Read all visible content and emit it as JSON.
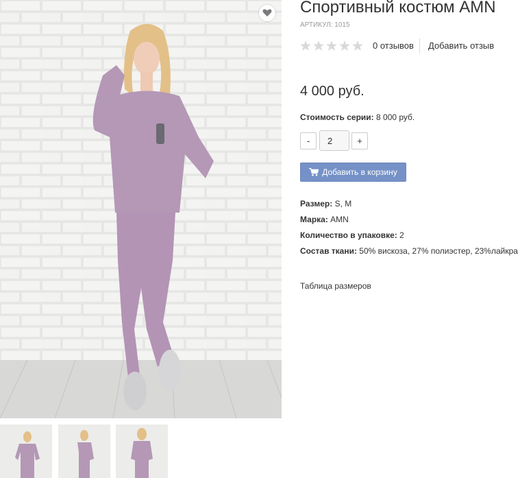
{
  "product": {
    "title": "Спортивный костюм AMN",
    "sku": "АРТИКУЛ: 1015",
    "rating": 0,
    "rating_max": 5,
    "reviews_count_label": "0 отзывов",
    "add_review_label": "Добавить отзыв",
    "price": "4 000 руб.",
    "series_label": "Стоимость серии:",
    "series_value": "8 000 руб."
  },
  "quantity": {
    "minus_label": "-",
    "value": "2",
    "plus_label": "+"
  },
  "cart": {
    "button_label": "Добавить в корзину",
    "icon": "shopping-cart-icon"
  },
  "attributes": [
    {
      "label": "Размер:",
      "value": "S, M"
    },
    {
      "label": "Марка:",
      "value": "AMN"
    },
    {
      "label": "Количество в упаковке:",
      "value": "2"
    },
    {
      "label": "Состав ткани:",
      "value": "50% вискоза, 27% полиэстер, 23%лайкра"
    }
  ],
  "size_table_label": "Таблица размеров",
  "colors": {
    "accent_button": "#7591c7",
    "garment": "#b498b6",
    "star_empty": "#d9d9d9",
    "wall": "#ececea"
  },
  "images": {
    "main": "photo of woman in lilac knit tracksuit against white brick wall",
    "thumbnails": [
      "front view",
      "side view",
      "back view"
    ]
  }
}
